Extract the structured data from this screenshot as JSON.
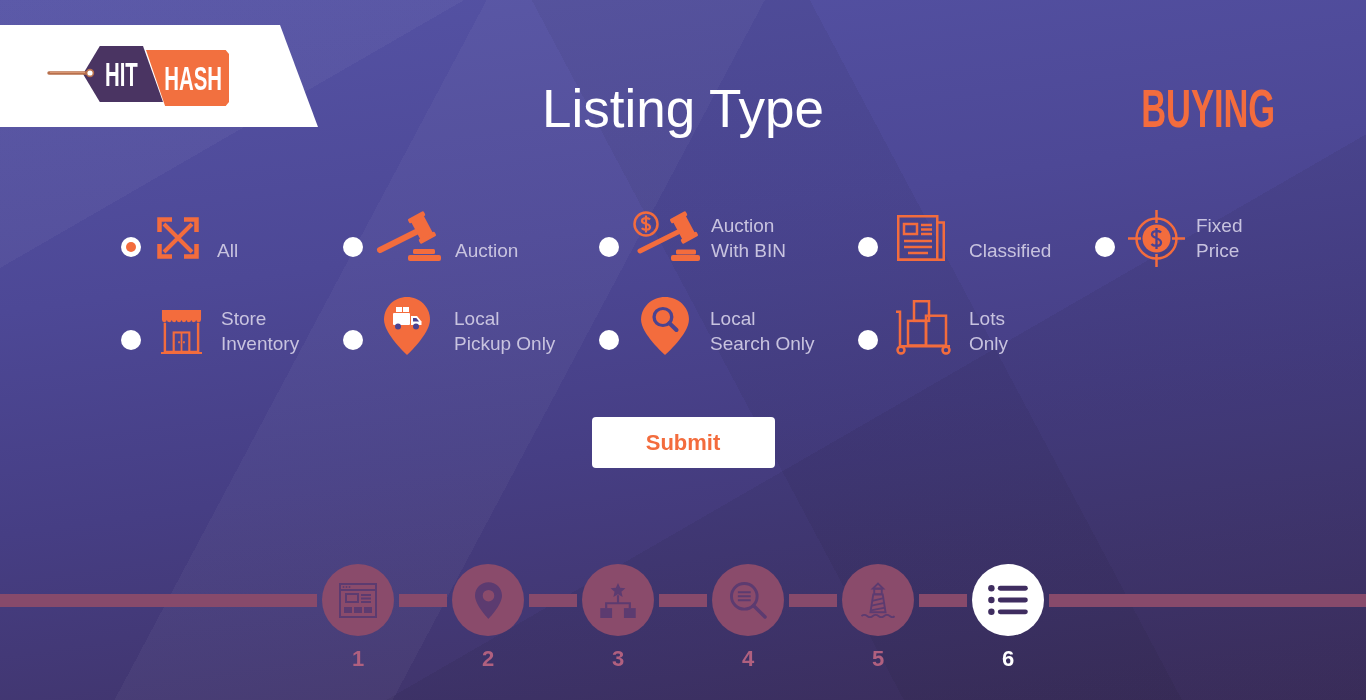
{
  "logo": {
    "tag_text": "HIT",
    "label_text": "HASH"
  },
  "title": "Listing Type",
  "mode": "BUYING",
  "options": [
    {
      "label": "All",
      "selected": true
    },
    {
      "label": "Auction",
      "selected": false
    },
    {
      "label": "Auction\nWith BIN",
      "selected": false
    },
    {
      "label": "Classified",
      "selected": false
    },
    {
      "label": "Fixed\nPrice",
      "selected": false
    },
    {
      "label": "Store\nInventory",
      "selected": false
    },
    {
      "label": "Local\nPickup Only",
      "selected": false
    },
    {
      "label": "Local\nSearch Only",
      "selected": false
    },
    {
      "label": "Lots\nOnly",
      "selected": false
    }
  ],
  "submit_button": "Submit",
  "steps": [
    {
      "number": "1",
      "selected": false
    },
    {
      "number": "2",
      "selected": false
    },
    {
      "number": "3",
      "selected": false
    },
    {
      "number": "4",
      "selected": false
    },
    {
      "number": "5",
      "selected": false
    },
    {
      "number": "6",
      "selected": true
    }
  ]
}
